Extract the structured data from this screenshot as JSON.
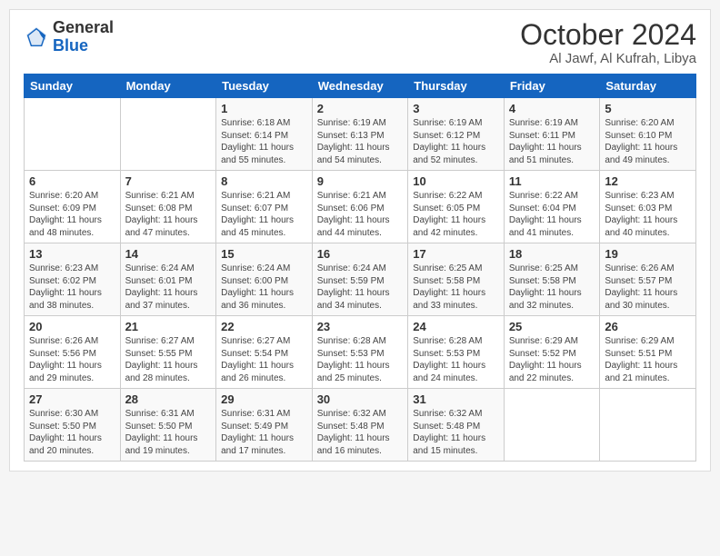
{
  "header": {
    "logo_general": "General",
    "logo_blue": "Blue",
    "month_title": "October 2024",
    "location": "Al Jawf, Al Kufrah, Libya"
  },
  "days_of_week": [
    "Sunday",
    "Monday",
    "Tuesday",
    "Wednesday",
    "Thursday",
    "Friday",
    "Saturday"
  ],
  "weeks": [
    [
      {
        "day": "",
        "info": ""
      },
      {
        "day": "",
        "info": ""
      },
      {
        "day": "1",
        "info": "Sunrise: 6:18 AM\nSunset: 6:14 PM\nDaylight: 11 hours and 55 minutes."
      },
      {
        "day": "2",
        "info": "Sunrise: 6:19 AM\nSunset: 6:13 PM\nDaylight: 11 hours and 54 minutes."
      },
      {
        "day": "3",
        "info": "Sunrise: 6:19 AM\nSunset: 6:12 PM\nDaylight: 11 hours and 52 minutes."
      },
      {
        "day": "4",
        "info": "Sunrise: 6:19 AM\nSunset: 6:11 PM\nDaylight: 11 hours and 51 minutes."
      },
      {
        "day": "5",
        "info": "Sunrise: 6:20 AM\nSunset: 6:10 PM\nDaylight: 11 hours and 49 minutes."
      }
    ],
    [
      {
        "day": "6",
        "info": "Sunrise: 6:20 AM\nSunset: 6:09 PM\nDaylight: 11 hours and 48 minutes."
      },
      {
        "day": "7",
        "info": "Sunrise: 6:21 AM\nSunset: 6:08 PM\nDaylight: 11 hours and 47 minutes."
      },
      {
        "day": "8",
        "info": "Sunrise: 6:21 AM\nSunset: 6:07 PM\nDaylight: 11 hours and 45 minutes."
      },
      {
        "day": "9",
        "info": "Sunrise: 6:21 AM\nSunset: 6:06 PM\nDaylight: 11 hours and 44 minutes."
      },
      {
        "day": "10",
        "info": "Sunrise: 6:22 AM\nSunset: 6:05 PM\nDaylight: 11 hours and 42 minutes."
      },
      {
        "day": "11",
        "info": "Sunrise: 6:22 AM\nSunset: 6:04 PM\nDaylight: 11 hours and 41 minutes."
      },
      {
        "day": "12",
        "info": "Sunrise: 6:23 AM\nSunset: 6:03 PM\nDaylight: 11 hours and 40 minutes."
      }
    ],
    [
      {
        "day": "13",
        "info": "Sunrise: 6:23 AM\nSunset: 6:02 PM\nDaylight: 11 hours and 38 minutes."
      },
      {
        "day": "14",
        "info": "Sunrise: 6:24 AM\nSunset: 6:01 PM\nDaylight: 11 hours and 37 minutes."
      },
      {
        "day": "15",
        "info": "Sunrise: 6:24 AM\nSunset: 6:00 PM\nDaylight: 11 hours and 36 minutes."
      },
      {
        "day": "16",
        "info": "Sunrise: 6:24 AM\nSunset: 5:59 PM\nDaylight: 11 hours and 34 minutes."
      },
      {
        "day": "17",
        "info": "Sunrise: 6:25 AM\nSunset: 5:58 PM\nDaylight: 11 hours and 33 minutes."
      },
      {
        "day": "18",
        "info": "Sunrise: 6:25 AM\nSunset: 5:58 PM\nDaylight: 11 hours and 32 minutes."
      },
      {
        "day": "19",
        "info": "Sunrise: 6:26 AM\nSunset: 5:57 PM\nDaylight: 11 hours and 30 minutes."
      }
    ],
    [
      {
        "day": "20",
        "info": "Sunrise: 6:26 AM\nSunset: 5:56 PM\nDaylight: 11 hours and 29 minutes."
      },
      {
        "day": "21",
        "info": "Sunrise: 6:27 AM\nSunset: 5:55 PM\nDaylight: 11 hours and 28 minutes."
      },
      {
        "day": "22",
        "info": "Sunrise: 6:27 AM\nSunset: 5:54 PM\nDaylight: 11 hours and 26 minutes."
      },
      {
        "day": "23",
        "info": "Sunrise: 6:28 AM\nSunset: 5:53 PM\nDaylight: 11 hours and 25 minutes."
      },
      {
        "day": "24",
        "info": "Sunrise: 6:28 AM\nSunset: 5:53 PM\nDaylight: 11 hours and 24 minutes."
      },
      {
        "day": "25",
        "info": "Sunrise: 6:29 AM\nSunset: 5:52 PM\nDaylight: 11 hours and 22 minutes."
      },
      {
        "day": "26",
        "info": "Sunrise: 6:29 AM\nSunset: 5:51 PM\nDaylight: 11 hours and 21 minutes."
      }
    ],
    [
      {
        "day": "27",
        "info": "Sunrise: 6:30 AM\nSunset: 5:50 PM\nDaylight: 11 hours and 20 minutes."
      },
      {
        "day": "28",
        "info": "Sunrise: 6:31 AM\nSunset: 5:50 PM\nDaylight: 11 hours and 19 minutes."
      },
      {
        "day": "29",
        "info": "Sunrise: 6:31 AM\nSunset: 5:49 PM\nDaylight: 11 hours and 17 minutes."
      },
      {
        "day": "30",
        "info": "Sunrise: 6:32 AM\nSunset: 5:48 PM\nDaylight: 11 hours and 16 minutes."
      },
      {
        "day": "31",
        "info": "Sunrise: 6:32 AM\nSunset: 5:48 PM\nDaylight: 11 hours and 15 minutes."
      },
      {
        "day": "",
        "info": ""
      },
      {
        "day": "",
        "info": ""
      }
    ]
  ]
}
